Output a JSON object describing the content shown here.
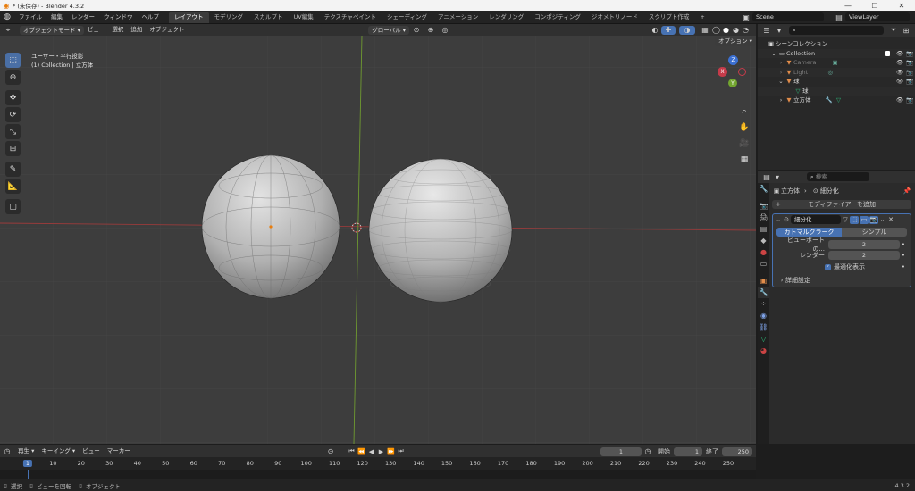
{
  "window": {
    "title": "* (未保存) - Blender 4.3.2",
    "minimize": "—",
    "maximize": "☐",
    "close": "✕"
  },
  "menu": [
    "ファイル",
    "編集",
    "レンダー",
    "ウィンドウ",
    "ヘルプ"
  ],
  "workspaces": [
    "レイアウト",
    "モデリング",
    "スカルプト",
    "UV編集",
    "テクスチャペイント",
    "シェーディング",
    "アニメーション",
    "レンダリング",
    "コンポジティング",
    "ジオメトリノード",
    "スクリプト作成"
  ],
  "workspace_add": "+",
  "scene": {
    "name": "Scene",
    "view_layer": "ViewLayer"
  },
  "viewport_header": {
    "mode": "オブジェクトモード",
    "view": "ビュー",
    "select": "選択",
    "add": "追加",
    "object": "オブジェクト",
    "orientation": "グローバル",
    "options": "オプション"
  },
  "viewport": {
    "view_name": "ユーザー・平行投影",
    "collection_info": "(1) Collection | 立方体"
  },
  "gizmo": {
    "x": "X",
    "y": "Y",
    "z": "Z"
  },
  "outliner": {
    "root": "シーンコレクション",
    "collection": "Collection",
    "items": [
      {
        "name": "Camera",
        "dim": true
      },
      {
        "name": "Light",
        "dim": true
      },
      {
        "name": "球",
        "dim": false
      },
      {
        "name": "球",
        "dim": false
      },
      {
        "name": "立方体",
        "dim": false
      }
    ],
    "search_placeholder": ""
  },
  "properties": {
    "search_placeholder": "検索",
    "breadcrumb_object": "立方体",
    "breadcrumb_modifier": "細分化",
    "add_modifier": "モディファイアーを追加",
    "modifier_name": "細分化",
    "tab_catmull": "カトマルクラーク",
    "tab_simple": "シンプル",
    "viewport_label": "ビューポートの...",
    "viewport_value": "2",
    "render_label": "レンダー",
    "render_value": "2",
    "optimal_display": "最適化表示",
    "advanced": "詳細設定"
  },
  "timeline": {
    "playback": "再生",
    "keying": "キーイング",
    "view": "ビュー",
    "marker": "マーカー",
    "current_frame": "1",
    "start_label": "開始",
    "start": "1",
    "end_label": "終了",
    "end": "250",
    "ticks": [
      "1",
      "10",
      "20",
      "30",
      "40",
      "50",
      "60",
      "70",
      "80",
      "90",
      "100",
      "110",
      "120",
      "130",
      "140",
      "150",
      "160",
      "170",
      "180",
      "190",
      "200",
      "210",
      "220",
      "230",
      "240",
      "250"
    ]
  },
  "status": {
    "select": "選択",
    "rotate": "ビューを回転",
    "object": "オブジェクト",
    "version": "4.3.2"
  },
  "colors": {
    "accent": "#4772b3",
    "x_axis": "#b83a3a",
    "y_axis": "#7fa34a",
    "z_axis": "#3b6fd1",
    "viewport_bg": "#3d3d3d"
  }
}
